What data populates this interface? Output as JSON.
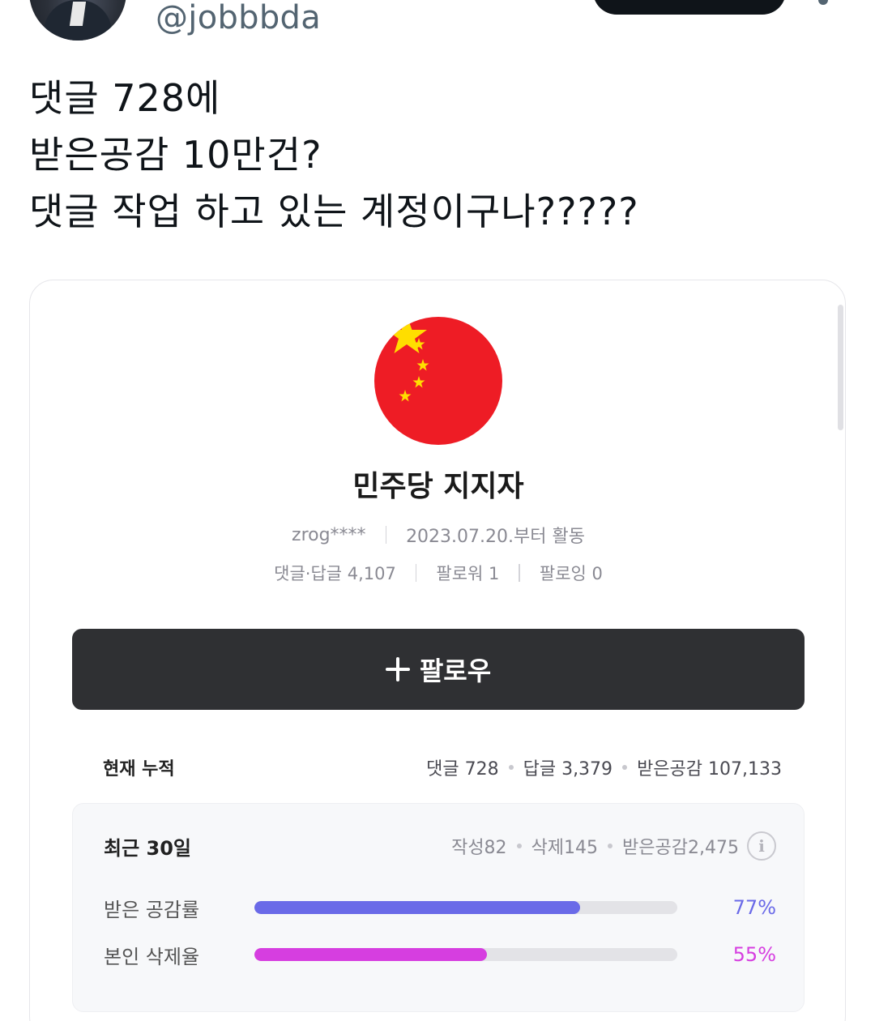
{
  "tweet": {
    "handle": "@jobbbda",
    "lines": [
      "댓글 728에",
      "받은공감 10만건?",
      "댓글 작업 하고 있는 계정이구나?????"
    ]
  },
  "card": {
    "avatar_icon": "china-flag-icon",
    "profile_name": "민주당 지지자",
    "user_id": "zrog****",
    "active_since": "2023.07.20.부터 활동",
    "comments_replies": "댓글·답글 4,107",
    "followers": "팔로워 1",
    "following": "팔로잉 0",
    "follow_button": "팔로우",
    "cumulative": {
      "label": "현재 누적",
      "comments": "댓글 728",
      "replies": "답글 3,379",
      "likes_received": "받은공감 107,133"
    },
    "recent": {
      "label": "최근 30일",
      "written": "작성82",
      "deleted": "삭제145",
      "likes_received": "받은공감2,475",
      "info_icon": "info-icon",
      "metrics": [
        {
          "label": "받은 공감률",
          "value": "77%",
          "percent": 77,
          "color": "#6a6ae8"
        },
        {
          "label": "본인 삭제율",
          "value": "55%",
          "percent": 55,
          "color": "#d63ee0"
        }
      ]
    }
  }
}
